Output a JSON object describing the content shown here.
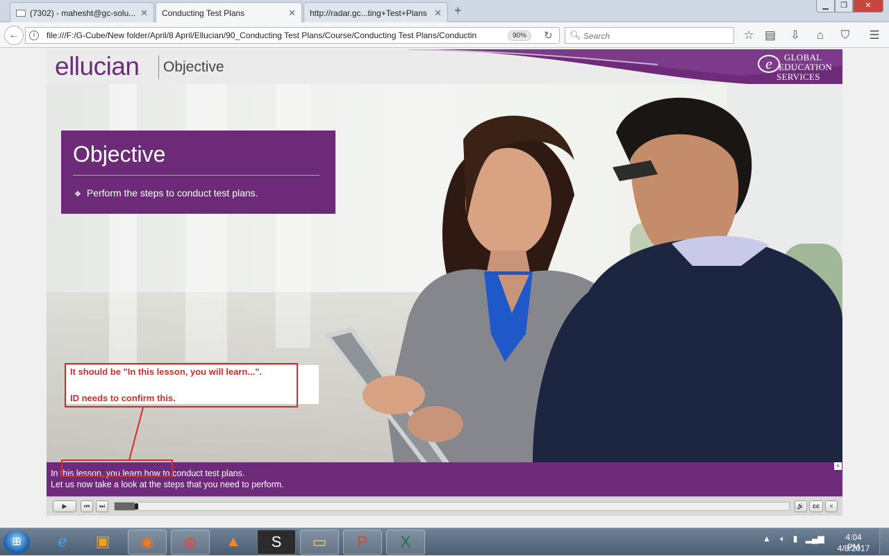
{
  "browser": {
    "tabs": [
      {
        "label": "(7302) - mahesht@gc-solu...",
        "icon": "mail-icon"
      },
      {
        "label": "Conducting Test Plans",
        "icon": "page-icon"
      },
      {
        "label": "http://radar.gc...ting+Test+Plans",
        "icon": "page-icon"
      }
    ],
    "new_tab": "+",
    "url": "file:///F:/G-Cube/New folder/April/8 April/Ellucian/90_Conducting Test Plans/Course/Conducting Test Plans/Conductin",
    "zoom": "90%",
    "search_placeholder": "Search"
  },
  "course": {
    "brand": "ellucian",
    "brand_mark": ".",
    "header_title": "Objective",
    "partner_logo": {
      "mark": "e",
      "lines": [
        "GLOBAL",
        "EDUCATION",
        "SERVICES"
      ]
    },
    "objective": {
      "heading": "Objective",
      "bullets": [
        "Perform the steps to conduct test plans."
      ]
    },
    "caption_lines": [
      "In this lesson, you learn how to conduct test plans.",
      "Let us now take a look at the steps that you need to perform."
    ],
    "caption_close": "×",
    "controls": {
      "play": "▶",
      "prev": "⏮",
      "next": "⏭",
      "volume": "🔊",
      "cc": "cc",
      "close": "×",
      "progress": 0.03
    }
  },
  "annotation": {
    "lines": [
      "It should be \"In this lesson, you will learn...\".",
      "ID needs to confirm this."
    ],
    "color": "#d42b2b"
  },
  "taskbar": {
    "time": "4:04 PM",
    "date": "4/8/2017",
    "apps": [
      "internet-explorer",
      "media-player",
      "firefox",
      "chrome",
      "vlc",
      "sublime",
      "file-explorer",
      "powerpoint",
      "excel"
    ]
  },
  "colors": {
    "brand_purple": "#6c2a78",
    "caption_purple": "#6d2b79"
  }
}
